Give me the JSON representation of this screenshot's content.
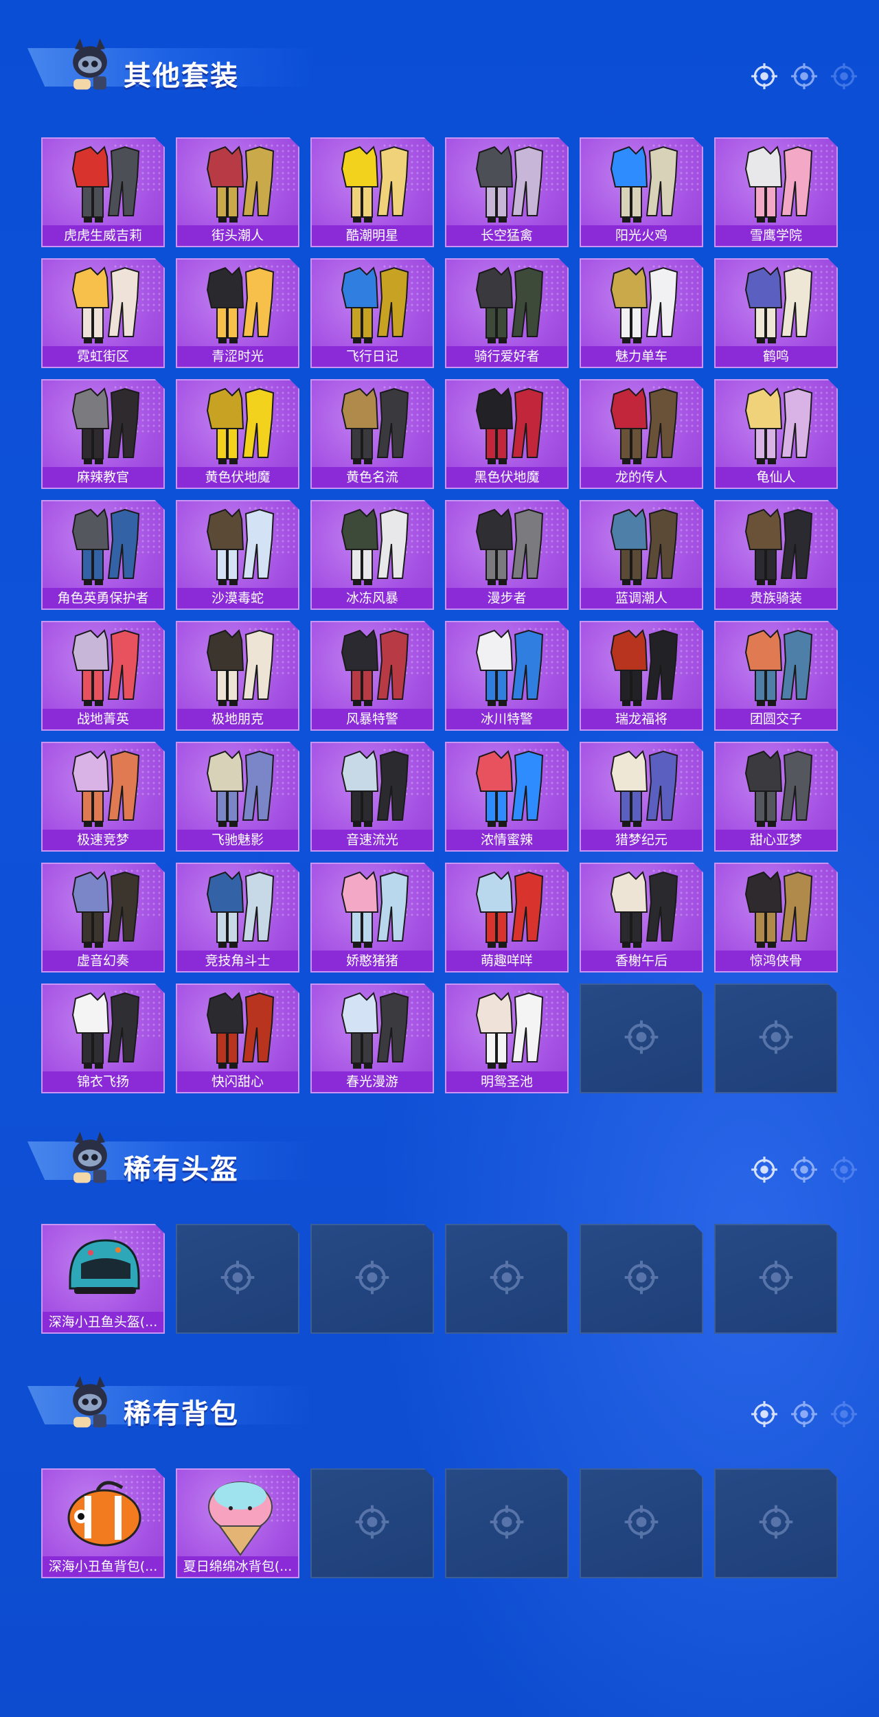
{
  "sections": [
    {
      "title": "其他套装",
      "items": [
        "虎虎生威吉莉",
        "街头潮人",
        "酷潮明星",
        "长空猛禽",
        "阳光火鸡",
        "雪鹰学院",
        "霓虹街区",
        "青涩时光",
        "飞行日记",
        "骑行爱好者",
        "魅力单车",
        "鹤鸣",
        "麻辣教官",
        "黄色伏地魔",
        "黄色名流",
        "黑色伏地魔",
        "龙的传人",
        "龟仙人",
        "角色英勇保护者",
        "沙漠毒蛇",
        "冰冻风暴",
        "漫步者",
        "蓝调潮人",
        "贵族骑装",
        "战地菁英",
        "极地朋克",
        "风暴特警",
        "冰川特警",
        "瑞龙福将",
        "团圆交子",
        "极速竞梦",
        "飞驰魅影",
        "音速流光",
        "浓情蜜辣",
        "猎梦纪元",
        "甜心亚梦",
        "虚音幻奏",
        "竞技角斗士",
        "娇憨猪猪",
        "萌趣咩咩",
        "香榭午后",
        "惊鸿侠骨",
        "锦衣飞扬",
        "快闪甜心",
        "春光漫游",
        "明鸳圣池"
      ],
      "empty_slots": 2
    },
    {
      "title": "稀有头盔",
      "items": [
        "深海小丑鱼头盔(..."
      ],
      "empty_slots": 5
    },
    {
      "title": "稀有背包",
      "items": [
        "深海小丑鱼背包(...",
        "夏日绵绵冰背包(..."
      ],
      "empty_slots": 4
    }
  ],
  "colors": {
    "background": "#0d4ccf",
    "card": "#a653e4",
    "label_bar": "#8b2bd8",
    "empty_slot": "#234478"
  },
  "icons": {
    "section_mascot": "mascot-icon",
    "header_decoration": "crosshair-icon",
    "empty_slot": "crosshair-icon"
  }
}
